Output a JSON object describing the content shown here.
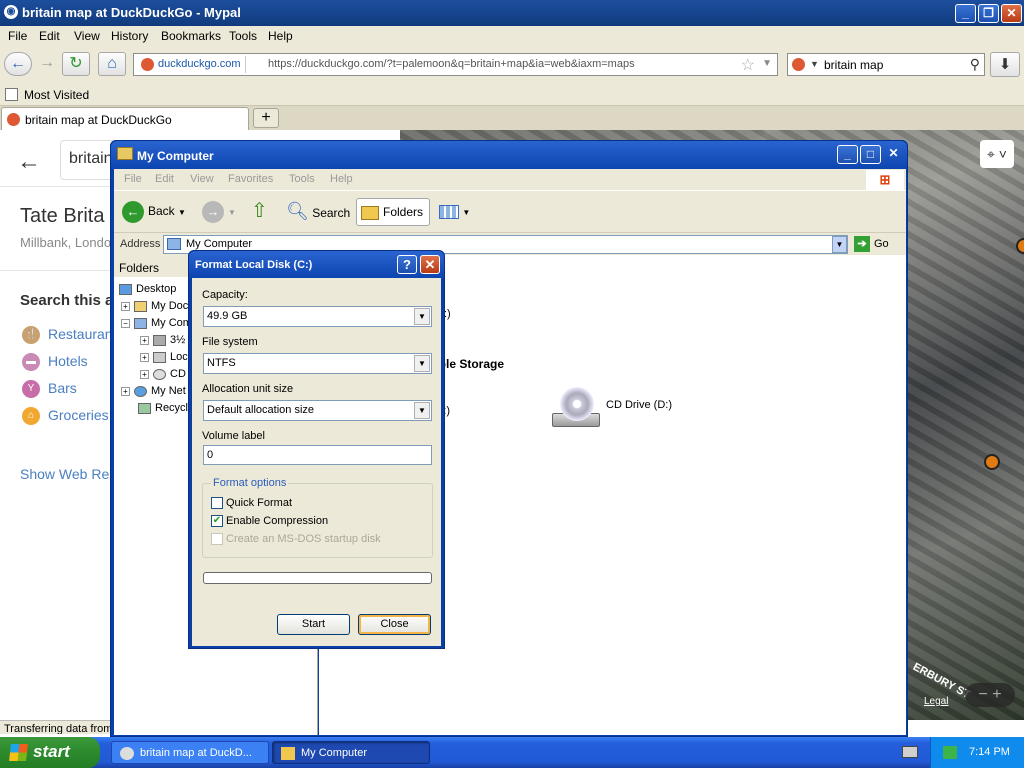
{
  "browser": {
    "title": "britain map at DuckDuckGo - Mypal",
    "menu": [
      "File",
      "Edit",
      "View",
      "History",
      "Bookmarks",
      "Tools",
      "Help"
    ],
    "site_label": "duckduckgo.com",
    "url": "https://duckduckgo.com/?t=palemoon&q=britain+map&ia=web&iaxm=maps",
    "search_value": "britain map",
    "bookmark": "Most Visited",
    "tab_title": "britain map at DuckDuckGo"
  },
  "page": {
    "search_query": "britain",
    "place_title": "Tate Brita",
    "place_subtitle": "Millbank, Londo",
    "search_area_label": "Search this a",
    "categories": [
      {
        "label": "Restauran",
        "color": "#c9a06e"
      },
      {
        "label": "Hotels",
        "color": "#c98bb6"
      },
      {
        "label": "Bars",
        "color": "#c76ea9"
      },
      {
        "label": "Groceries",
        "color": "#f0a830"
      }
    ],
    "show_web": "Show Web Res",
    "status": "Transferring data from",
    "map_legal": "Legal",
    "map_street": "ERBURY ST"
  },
  "explorer": {
    "title": "My Computer",
    "menu": [
      "File",
      "Edit",
      "View",
      "Favorites",
      "Tools",
      "Help"
    ],
    "toolbar": {
      "back": "Back",
      "search": "Search",
      "folders": "Folders"
    },
    "address_label": "Address",
    "address_value": "My Computer",
    "go": "Go",
    "folders_header": "Folders",
    "tree": [
      "Desktop",
      "My Doc",
      "My Com",
      "3½",
      "Loc",
      "CD",
      "My Net",
      "Recycl"
    ],
    "right": {
      "local_disk_partial": "C:)",
      "removable_header": "able Storage",
      "floppy_partial": "A:)",
      "cd_drive": "CD Drive (D:)"
    }
  },
  "format_dialog": {
    "title": "Format Local Disk (C:)",
    "capacity_label": "Capacity:",
    "capacity_value": "49.9 GB",
    "filesystem_label": "File system",
    "filesystem_value": "NTFS",
    "alloc_label": "Allocation unit size",
    "alloc_value": "Default allocation size",
    "volume_label": "Volume label",
    "volume_value": "0",
    "options_label": "Format options",
    "quick_format": "Quick Format",
    "enable_compression": "Enable Compression",
    "msdos_disk": "Create an MS-DOS startup disk",
    "start_button": "Start",
    "close_button": "Close",
    "quick_format_checked": false,
    "compression_checked": true,
    "progress": 0
  },
  "taskbar": {
    "start": "start",
    "task1": "britain map at DuckD...",
    "task2": "My Computer",
    "clock": "7:14 PM"
  }
}
